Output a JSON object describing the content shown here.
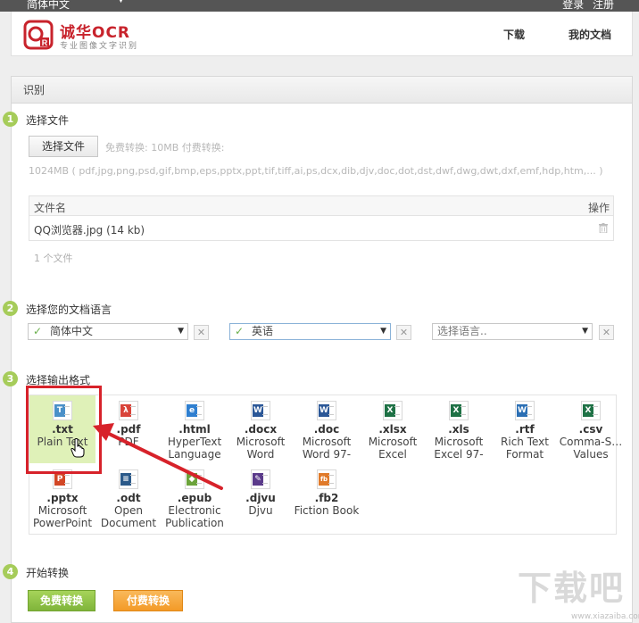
{
  "topbar": {
    "language": "简体中文",
    "login": "登录",
    "register": "注册"
  },
  "header": {
    "logo_title": "诚华OCR",
    "logo_sub": "专业图像文字识别",
    "nav_download": "下载",
    "nav_docs": "我的文档"
  },
  "panel": {
    "title": "识别"
  },
  "step1": {
    "num": "1",
    "title": "选择文件",
    "choose_button": "选择文件",
    "limits": "免费转换: 10MB  付费转换:",
    "formats": "1024MB  ( pdf,jpg,png,psd,gif,bmp,eps,pptx,ppt,tif,tiff,ai,ps,dcx,dib,djv,doc,dot,dst,dwf,dwg,dwt,dxf,emf,hdp,htm,... )",
    "table": {
      "col_name": "文件名",
      "col_action": "操作"
    },
    "files": [
      {
        "name": "QQ浏览器.jpg (14 kb)"
      }
    ],
    "count": "1 个文件"
  },
  "step2": {
    "num": "2",
    "title": "选择您的文档语言",
    "languages": [
      {
        "value": "简体中文"
      },
      {
        "value": "英语"
      },
      {
        "placeholder": "选择语言.."
      }
    ]
  },
  "step3": {
    "num": "3",
    "title": "选择输出格式",
    "formats": [
      {
        "ext": ".txt",
        "line1": "Plain Text",
        "line2": "",
        "icon": "txt-icon",
        "color": "#4a90c8",
        "badge": "T",
        "selected": true
      },
      {
        "ext": ".pdf",
        "line1": "PDF",
        "line2": "",
        "icon": "pdf-icon",
        "color": "#d9443a",
        "badge": "λ"
      },
      {
        "ext": ".html",
        "line1": "HyperText",
        "line2": "Language",
        "icon": "html-icon",
        "color": "#2f7fd0",
        "badge": "e"
      },
      {
        "ext": ".docx",
        "line1": "Microsoft",
        "line2": "Word",
        "icon": "docx-icon",
        "color": "#2b5797",
        "badge": "W"
      },
      {
        "ext": ".doc",
        "line1": "Microsoft",
        "line2": "Word 97-",
        "icon": "doc-icon",
        "color": "#2b5797",
        "badge": "W"
      },
      {
        "ext": ".xlsx",
        "line1": "Microsoft",
        "line2": "Excel",
        "icon": "xlsx-icon",
        "color": "#1e7145",
        "badge": "X"
      },
      {
        "ext": ".xls",
        "line1": "Microsoft",
        "line2": "Excel 97-",
        "icon": "xls-icon",
        "color": "#1e7145",
        "badge": "X"
      },
      {
        "ext": ".rtf",
        "line1": "Rich Text",
        "line2": "Format",
        "icon": "rtf-icon",
        "color": "#2b6fb4",
        "badge": "W"
      },
      {
        "ext": ".csv",
        "line1": "Comma-S…",
        "line2": "Values",
        "icon": "csv-icon",
        "color": "#1e7145",
        "badge": "X"
      },
      {
        "ext": ".pptx",
        "line1": "Microsoft",
        "line2": "PowerPoint",
        "icon": "pptx-icon",
        "color": "#d24726",
        "badge": "P"
      },
      {
        "ext": ".odt",
        "line1": "Open",
        "line2": "Document",
        "icon": "odt-icon",
        "color": "#2b5a8a",
        "badge": "≡"
      },
      {
        "ext": ".epub",
        "line1": "Electronic",
        "line2": "Publication",
        "icon": "epub-icon",
        "color": "#6ba33a",
        "badge": "◆"
      },
      {
        "ext": ".djvu",
        "line1": "Djvu",
        "line2": "",
        "icon": "djvu-icon",
        "color": "#5a3a8a",
        "badge": "✎"
      },
      {
        "ext": ".fb2",
        "line1": "Fiction Book",
        "line2": "",
        "icon": "fb2-icon",
        "color": "#e07a2a",
        "badge": "fb"
      }
    ]
  },
  "step4": {
    "num": "4",
    "title": "开始转换",
    "free_button": "免费转换",
    "paid_button": "付费转换"
  },
  "watermark": {
    "text": "下载吧",
    "url": "www.xiazaiba.com"
  }
}
